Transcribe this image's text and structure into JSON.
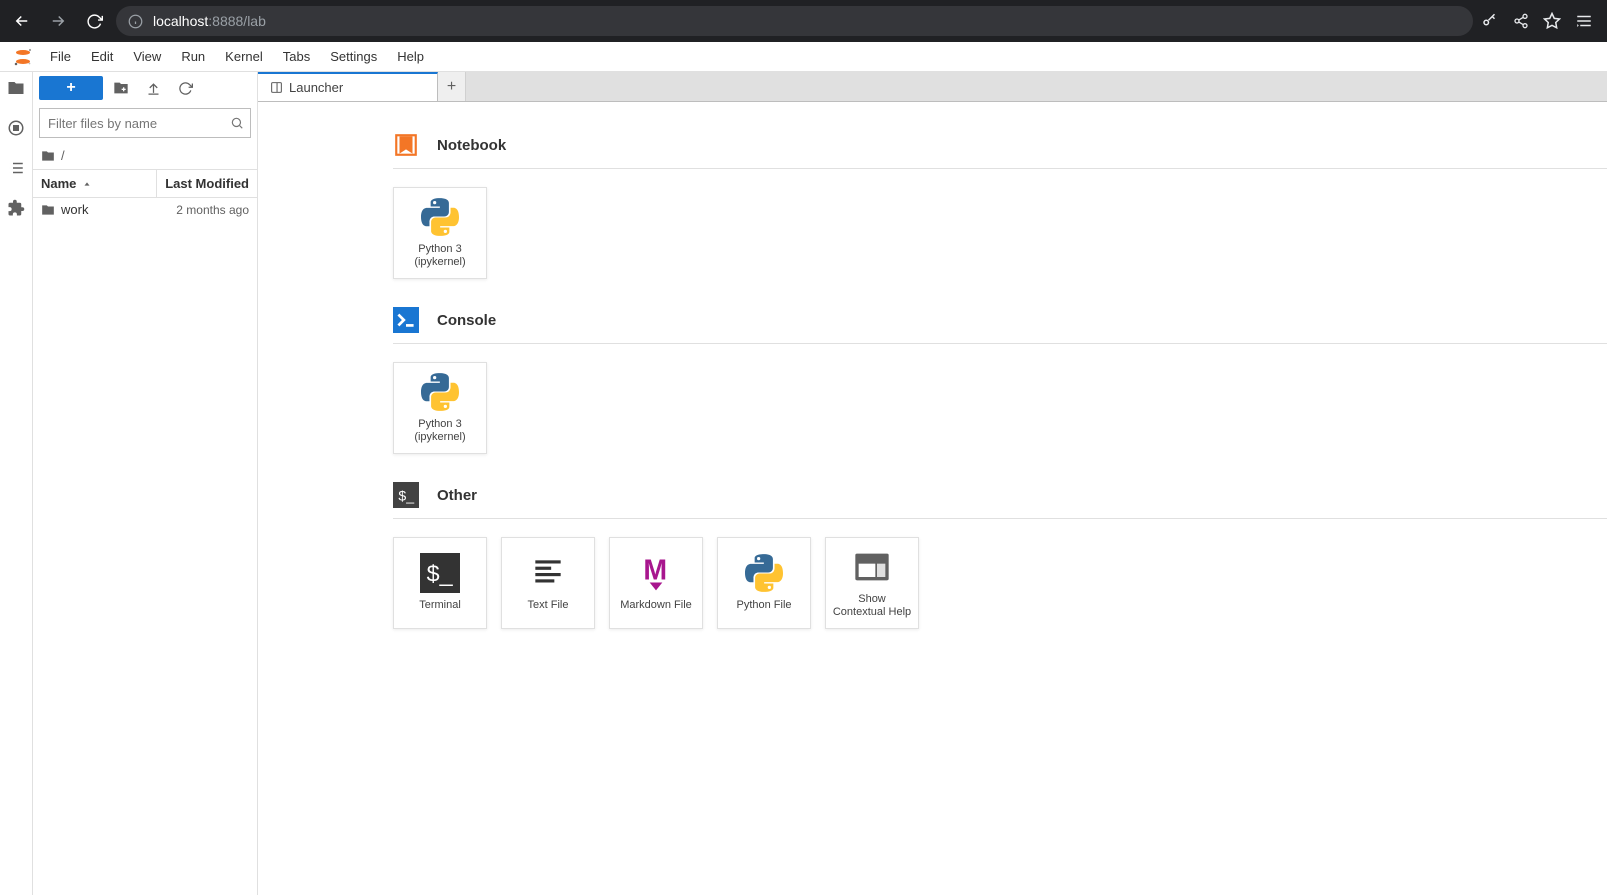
{
  "browser": {
    "url_host": "localhost",
    "url_port": ":8888/lab"
  },
  "menubar": {
    "items": [
      "File",
      "Edit",
      "View",
      "Run",
      "Kernel",
      "Tabs",
      "Settings",
      "Help"
    ]
  },
  "file_panel": {
    "filter_placeholder": "Filter files by name",
    "breadcrumb": "/",
    "columns": {
      "name": "Name",
      "modified": "Last Modified"
    },
    "rows": [
      {
        "name": "work",
        "modified": "2 months ago"
      }
    ]
  },
  "tabs": {
    "active": "Launcher"
  },
  "launcher": {
    "sections": {
      "notebook": {
        "title": "Notebook",
        "cards": [
          {
            "label": "Python 3\n(ipykernel)"
          }
        ]
      },
      "console": {
        "title": "Console",
        "cards": [
          {
            "label": "Python 3\n(ipykernel)"
          }
        ]
      },
      "other": {
        "title": "Other",
        "cards": [
          {
            "label": "Terminal"
          },
          {
            "label": "Text File"
          },
          {
            "label": "Markdown File"
          },
          {
            "label": "Python File"
          },
          {
            "label": "Show\nContextual Help"
          }
        ]
      }
    }
  }
}
